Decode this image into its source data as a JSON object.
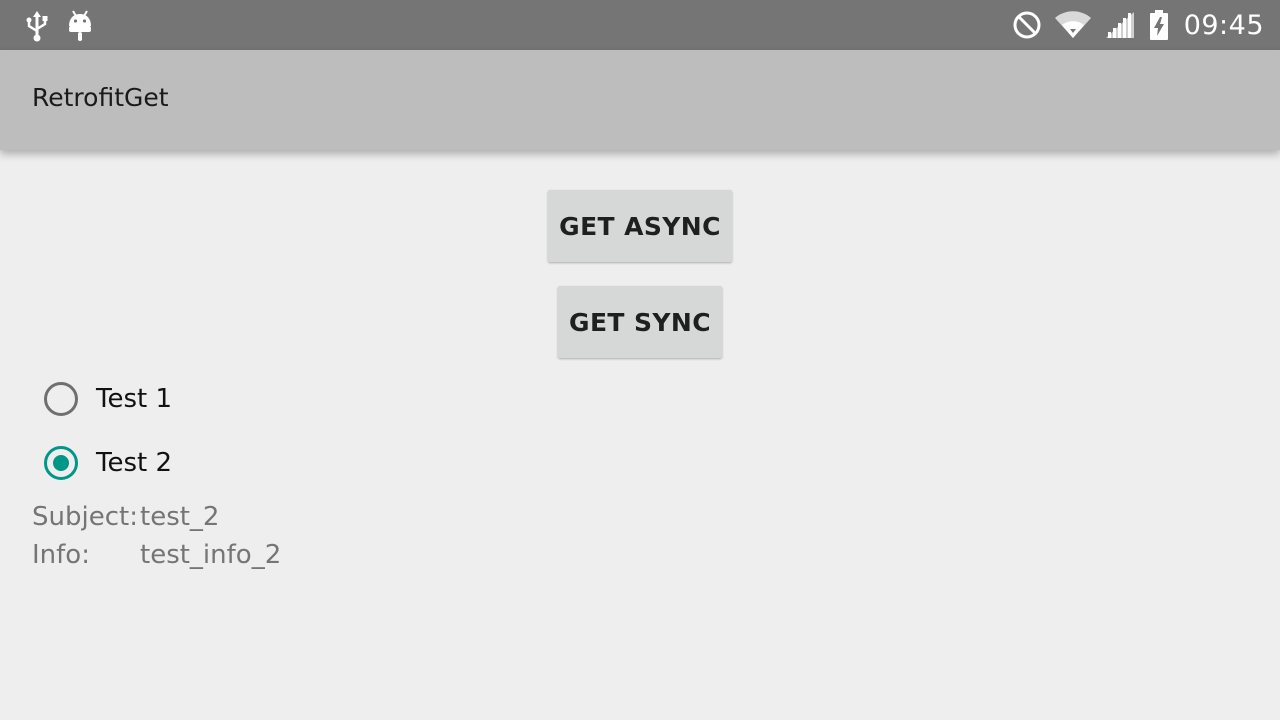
{
  "status_bar": {
    "time": "09:45",
    "left_icons": [
      "usb-icon",
      "android-icon"
    ],
    "right_icons": [
      "do-not-disturb-icon",
      "wifi-icon",
      "cell-signal-icon",
      "battery-charging-icon"
    ]
  },
  "app_bar": {
    "title": "RetrofitGet"
  },
  "buttons": {
    "get_async": "GET ASYNC",
    "get_sync": "GET SYNC"
  },
  "radio_group": {
    "options": [
      {
        "label": "Test 1",
        "checked": false
      },
      {
        "label": "Test 2",
        "checked": true
      }
    ]
  },
  "details": {
    "subject_label": "Subject:",
    "subject_value": "test_2",
    "info_label": "Info:",
    "info_value": "test_info_2"
  },
  "colors": {
    "status_bar": "#757575",
    "app_bar": "#bdbdbd",
    "background": "#eeeeee",
    "accent": "#009688",
    "button": "#d6d7d7"
  }
}
